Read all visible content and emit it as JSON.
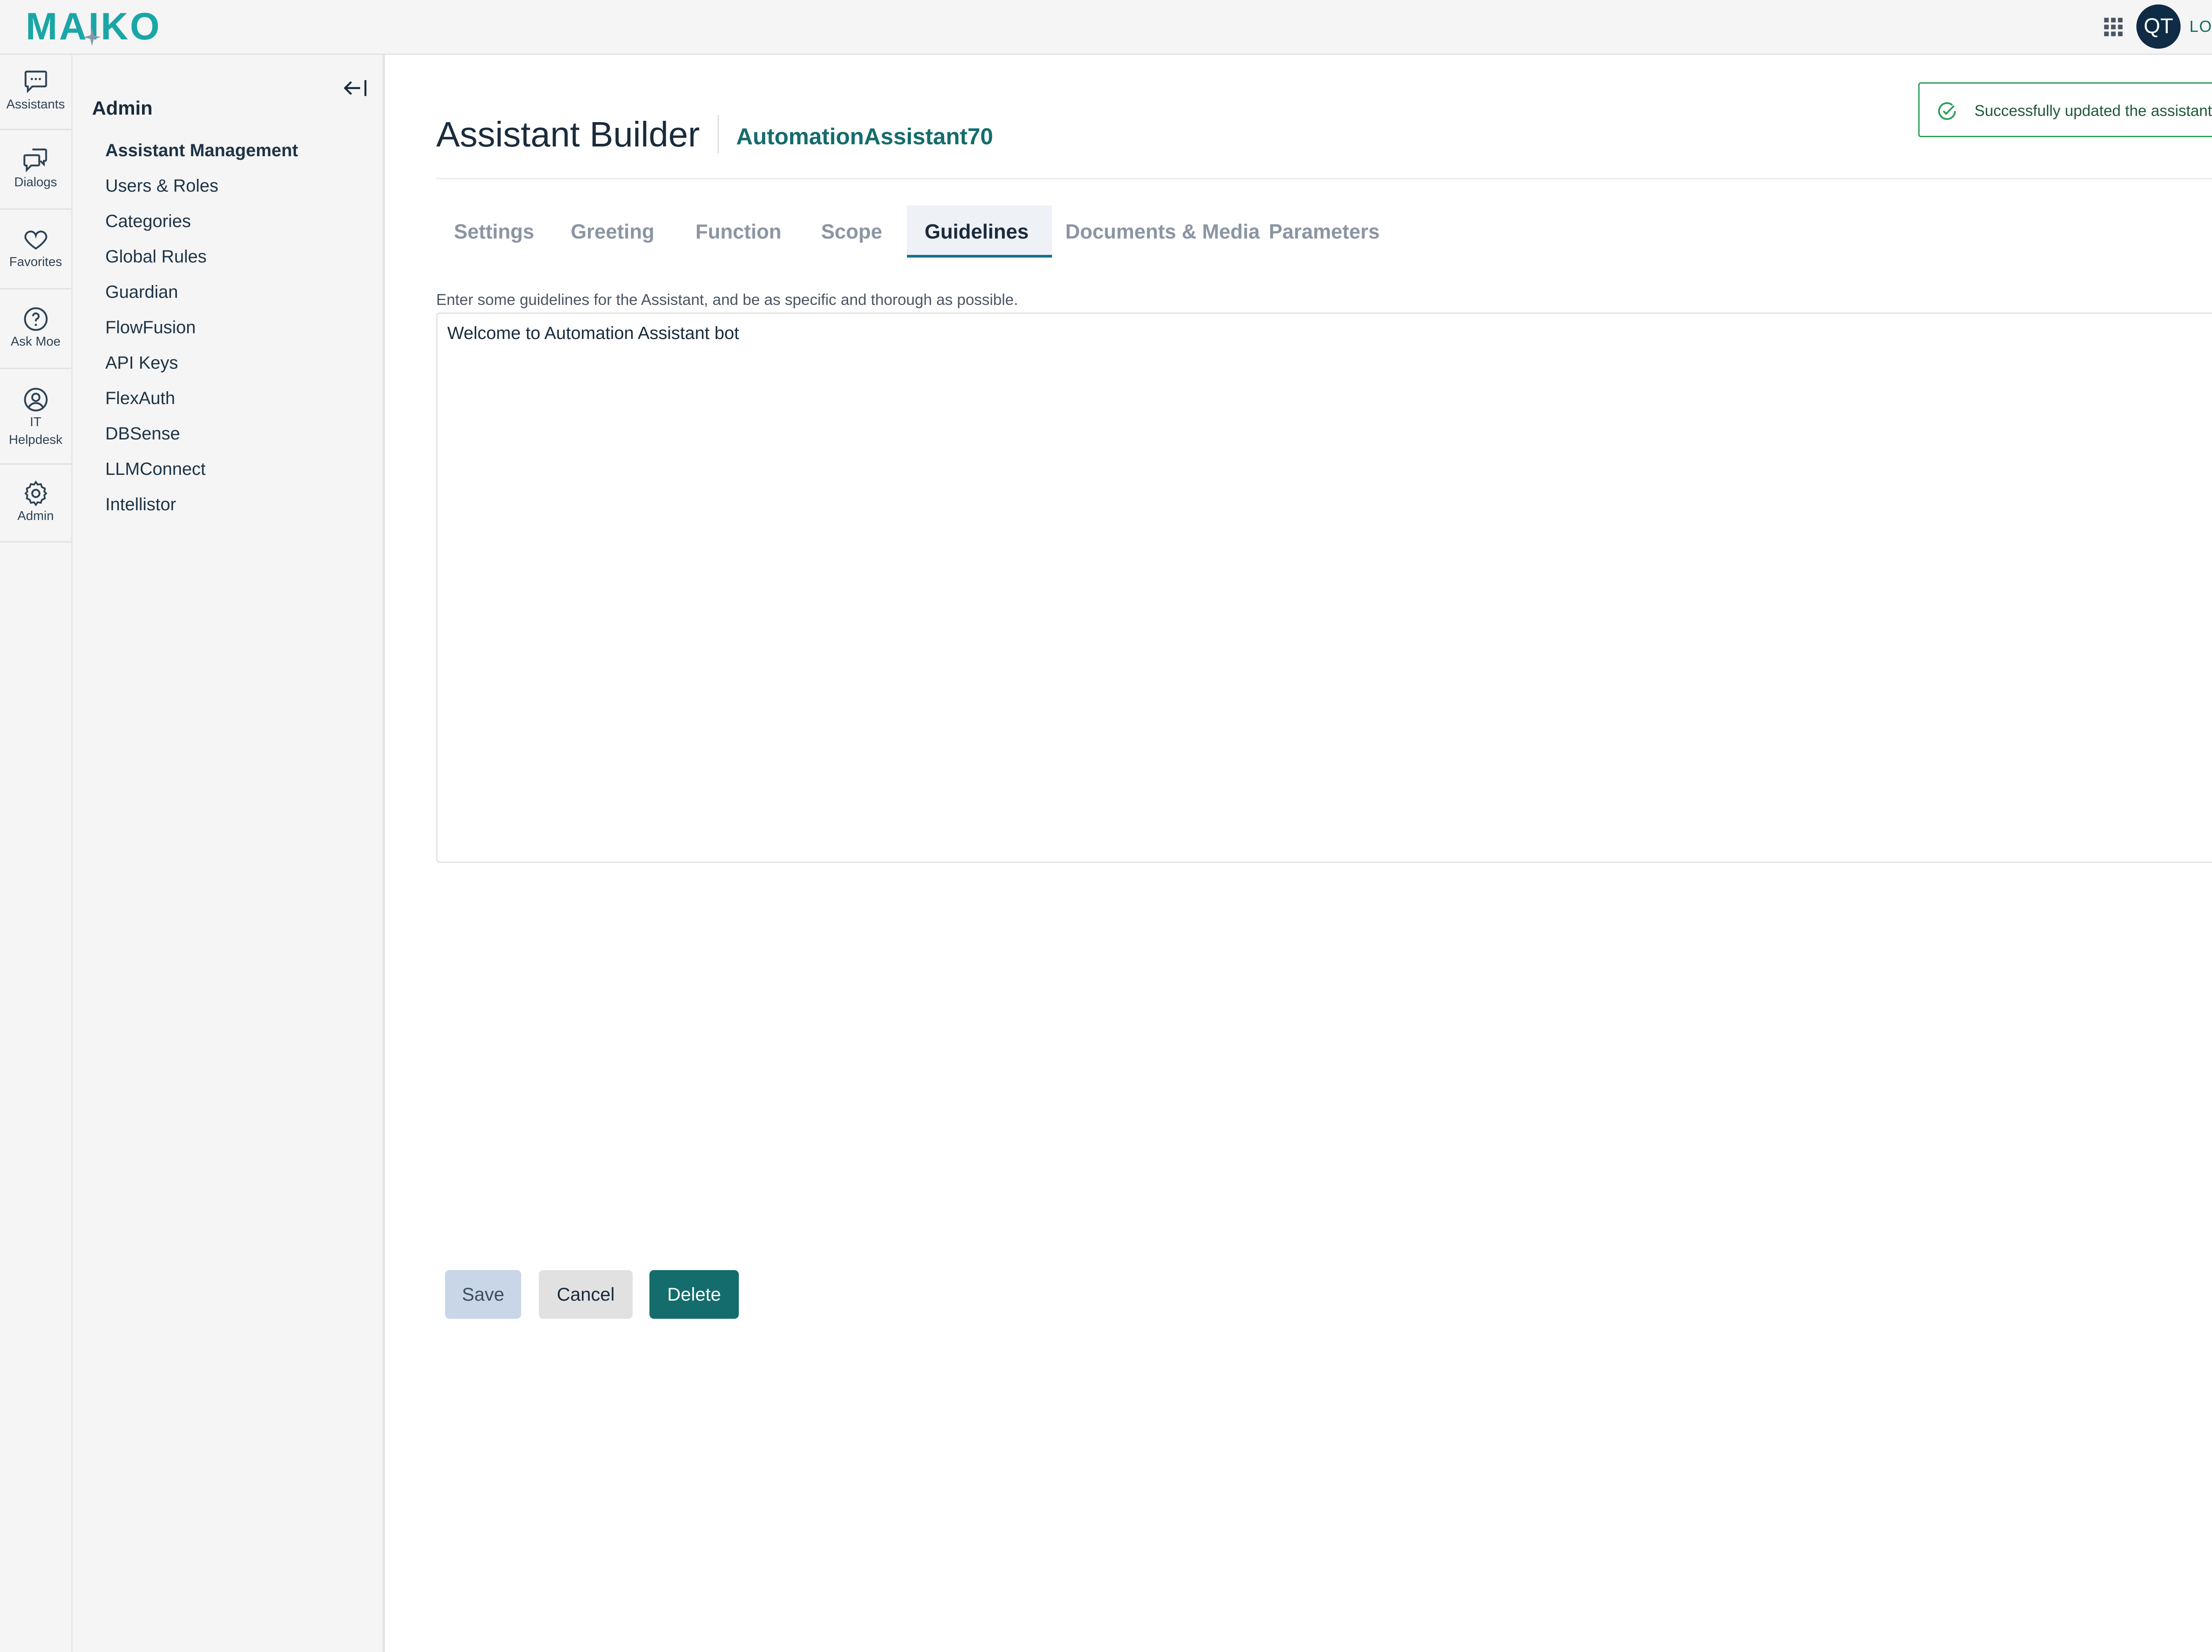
{
  "brand": {
    "logo_text": "MAIKO",
    "accent_color": "#1aa6a6",
    "primary_color": "#146c6c"
  },
  "topbar": {
    "apps_icon": "grid-icon",
    "avatar_initials": "QT",
    "logout_label": "LOGOUT"
  },
  "rail": {
    "items": [
      {
        "label": "Assistants",
        "icon": "chat-bubble-icon"
      },
      {
        "label": "Dialogs",
        "icon": "dialogs-icon"
      },
      {
        "label": "Favorites",
        "icon": "heart-icon"
      },
      {
        "label": "Ask Moe",
        "icon": "question-circle-icon"
      },
      {
        "label_line1": "IT",
        "label_line2": "Helpdesk",
        "icon": "user-circle-icon"
      },
      {
        "label": "Admin",
        "icon": "gear-icon"
      }
    ]
  },
  "sidebar": {
    "title": "Admin",
    "collapse_icon": "collapse-left-icon",
    "items": [
      {
        "label": "Assistant Management",
        "active": true
      },
      {
        "label": "Users & Roles"
      },
      {
        "label": "Categories"
      },
      {
        "label": "Global Rules"
      },
      {
        "label": "Guardian"
      },
      {
        "label": "FlowFusion"
      },
      {
        "label": "API Keys"
      },
      {
        "label": "FlexAuth"
      },
      {
        "label": "DBSense"
      },
      {
        "label": "LLMConnect"
      },
      {
        "label": "Intellistor"
      }
    ]
  },
  "main": {
    "title": "Assistant Builder",
    "assistant_name": "AutomationAssistant70",
    "tabs": [
      {
        "label": "Settings"
      },
      {
        "label": "Greeting"
      },
      {
        "label": "Function"
      },
      {
        "label": "Scope"
      },
      {
        "label": "Guidelines",
        "active": true
      },
      {
        "label": "Documents & Media"
      },
      {
        "label": "Parameters"
      }
    ],
    "instructions": "Enter some guidelines for the Assistant, and be as specific and thorough as possible.",
    "guidelines_value": "Welcome to Automation Assistant bot",
    "buttons": {
      "save": "Save",
      "cancel": "Cancel",
      "delete": "Delete"
    }
  },
  "toast": {
    "message": "Successfully updated the assistant.",
    "status_color": "#2e9e5b",
    "icon": "check-circle-icon",
    "close_icon": "close-icon"
  }
}
